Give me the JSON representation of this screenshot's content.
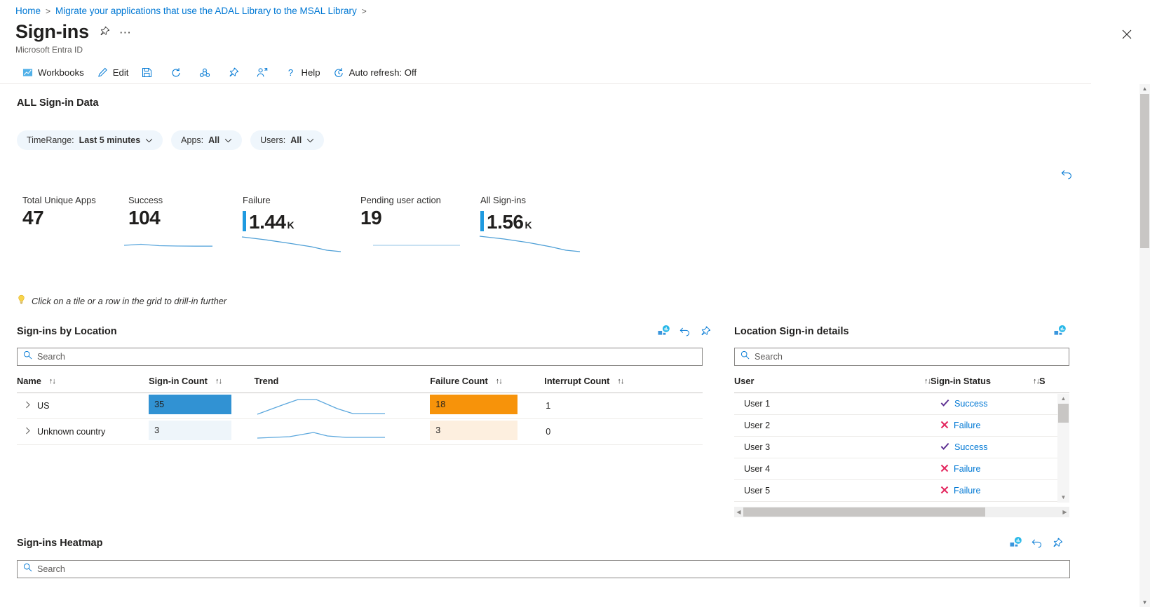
{
  "breadcrumb": {
    "items": [
      {
        "label": "Home"
      },
      {
        "label": "Migrate your applications that use the ADAL Library to the MSAL Library"
      }
    ],
    "separator": ">"
  },
  "header": {
    "title": "Sign-ins",
    "subtitle": "Microsoft Entra ID",
    "pin_icon": "pin-icon",
    "more_icon": "ellipsis-icon",
    "close_icon": "close-icon"
  },
  "command_bar": {
    "items": [
      {
        "name": "workbooks",
        "label": "Workbooks",
        "icon": "workbooks-icon"
      },
      {
        "name": "edit",
        "label": "Edit",
        "icon": "pencil-icon"
      },
      {
        "name": "save",
        "label": "",
        "icon": "save-icon"
      },
      {
        "name": "refresh",
        "label": "",
        "icon": "refresh-icon"
      },
      {
        "name": "share",
        "label": "",
        "icon": "share-icon"
      },
      {
        "name": "pin",
        "label": "",
        "icon": "pin-icon"
      },
      {
        "name": "assign",
        "label": "",
        "icon": "person-pin-icon"
      },
      {
        "name": "help",
        "label": "Help",
        "icon": "question-icon"
      },
      {
        "name": "auto-refresh",
        "label": "Auto refresh: Off",
        "icon": "clock-refresh-icon"
      }
    ]
  },
  "section": {
    "title": "ALL Sign-in Data"
  },
  "filters": [
    {
      "name": "timerange",
      "prefix": "TimeRange: ",
      "value": "Last 5 minutes"
    },
    {
      "name": "apps",
      "prefix": "Apps: ",
      "value": "All"
    },
    {
      "name": "users",
      "prefix": "Users: ",
      "value": "All"
    }
  ],
  "kpis": [
    {
      "name": "total-unique-apps",
      "label": "Total Unique Apps",
      "value": "47",
      "unit": "",
      "has_bar": false,
      "has_spark": false
    },
    {
      "name": "success",
      "label": "Success",
      "value": "104",
      "unit": "",
      "has_bar": false,
      "has_spark": true
    },
    {
      "name": "failure",
      "label": "Failure",
      "value": "1.44",
      "unit": "K",
      "has_bar": true,
      "has_spark": true
    },
    {
      "name": "pending-user-action",
      "label": "Pending user action",
      "value": "19",
      "unit": "",
      "has_bar": false,
      "has_spark": true
    },
    {
      "name": "all-sign-ins",
      "label": "All Sign-ins",
      "value": "1.56",
      "unit": "K",
      "has_bar": true,
      "has_spark": true
    }
  ],
  "hint": {
    "icon": "lightbulb-icon",
    "text": "Click on a tile or a row in the grid to drill-in further"
  },
  "locations_panel": {
    "title": "Sign-ins by Location",
    "actions": [
      {
        "name": "open-chart-icon",
        "icon": "chart-tile-icon"
      },
      {
        "name": "revert-icon",
        "icon": "undo-icon"
      },
      {
        "name": "pin-icon",
        "icon": "pin-icon"
      }
    ],
    "search_placeholder": "Search",
    "search_value": "",
    "columns": [
      {
        "label": "Name",
        "sortable": true
      },
      {
        "label": "Sign-in Count",
        "sortable": true
      },
      {
        "label": "Trend",
        "sortable": false
      },
      {
        "label": "Failure Count",
        "sortable": true
      },
      {
        "label": "Interrupt Count",
        "sortable": true
      }
    ],
    "rows": [
      {
        "name": "US",
        "signin_count": "35",
        "signin_pct": 100,
        "failure_count": "18",
        "failure_pct": 100,
        "interrupt_count": "1"
      },
      {
        "name": "Unknown country",
        "signin_count": "3",
        "signin_pct": 9,
        "failure_count": "3",
        "failure_pct": 17,
        "interrupt_count": "0"
      }
    ]
  },
  "details_panel": {
    "title": "Location Sign-in details",
    "actions": [
      {
        "name": "open-chart-icon",
        "icon": "chart-tile-icon"
      }
    ],
    "search_placeholder": "Search",
    "search_value": "",
    "columns": [
      {
        "label": "User",
        "sortable": true
      },
      {
        "label": "Sign-in Status",
        "sortable": true
      },
      {
        "label": "S",
        "sortable": false
      }
    ],
    "rows": [
      {
        "user": "User 1",
        "status": "Success",
        "status_icon": "check-icon"
      },
      {
        "user": "User 2",
        "status": "Failure",
        "status_icon": "cross-icon"
      },
      {
        "user": "User 3",
        "status": "Success",
        "status_icon": "check-icon"
      },
      {
        "user": "User 4",
        "status": "Failure",
        "status_icon": "cross-icon"
      },
      {
        "user": "User 5",
        "status": "Failure",
        "status_icon": "cross-icon"
      }
    ]
  },
  "heatmap_panel": {
    "title": "Sign-ins Heatmap",
    "actions": [
      {
        "name": "open-chart-icon",
        "icon": "chart-tile-icon"
      },
      {
        "name": "revert-icon",
        "icon": "undo-icon"
      },
      {
        "name": "pin-icon",
        "icon": "pin-icon"
      }
    ],
    "search_placeholder": "Search",
    "search_value": ""
  },
  "colors": {
    "accent": "#0078d4",
    "bar_blue": "#3192d3",
    "bar_blue_faint": "#eef5fa",
    "bar_orange": "#f7930a",
    "bar_orange_faint": "#fdefdf",
    "success": "#5c2e91",
    "failure": "#e3265e",
    "pill_bg": "#eff6fc",
    "spark_line": "#5ba7dd"
  },
  "chart_data": [
    {
      "type": "line",
      "title": "Success trend sparkline",
      "x": [
        0,
        1,
        2,
        3,
        4,
        5
      ],
      "values": [
        6,
        5,
        7,
        8,
        9,
        9
      ],
      "grid": false,
      "legend": false
    },
    {
      "type": "line",
      "title": "Failure trend sparkline",
      "x": [
        0,
        1,
        2,
        3,
        4,
        5
      ],
      "values": [
        20,
        18,
        14,
        11,
        8,
        5
      ],
      "grid": false,
      "legend": false
    },
    {
      "type": "line",
      "title": "Pending user action trend sparkline",
      "x": [
        0,
        1,
        2,
        3,
        4,
        5
      ],
      "values": [
        5,
        5,
        5,
        5,
        5,
        5
      ],
      "grid": false,
      "legend": false
    },
    {
      "type": "line",
      "title": "All Sign-ins trend sparkline",
      "x": [
        0,
        1,
        2,
        3,
        4,
        5
      ],
      "values": [
        20,
        18,
        15,
        13,
        9,
        4
      ],
      "grid": false,
      "legend": false
    },
    {
      "type": "line",
      "title": "US trend",
      "x": [
        0,
        1,
        2,
        3,
        4,
        5,
        6
      ],
      "values": [
        2,
        10,
        16,
        16,
        12,
        4,
        3
      ],
      "grid": false,
      "legend": false
    },
    {
      "type": "line",
      "title": "Unknown country trend",
      "x": [
        0,
        1,
        2,
        3,
        4,
        5,
        6
      ],
      "values": [
        1,
        1,
        3,
        5,
        3,
        1,
        1
      ],
      "grid": false,
      "legend": false
    },
    {
      "type": "bar",
      "title": "Sign-ins by Location",
      "categories": [
        "US",
        "Unknown country"
      ],
      "series": [
        {
          "name": "Sign-in Count",
          "values": [
            35,
            3
          ]
        },
        {
          "name": "Failure Count",
          "values": [
            18,
            3
          ]
        },
        {
          "name": "Interrupt Count",
          "values": [
            1,
            0
          ]
        }
      ],
      "xlabel": "",
      "ylabel": "",
      "grid": false,
      "legend": false
    }
  ]
}
